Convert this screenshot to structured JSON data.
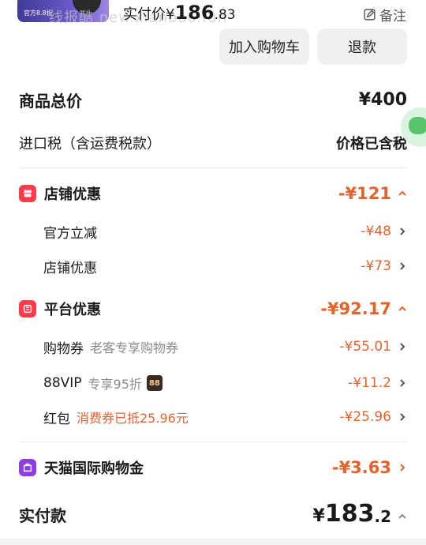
{
  "top": {
    "thumb_text": "官方8.8折",
    "watermark": "线报酷 new.xianbao.fun",
    "paid_label": "实付价",
    "paid_symbol": "¥",
    "paid_int": "186",
    "paid_dec": ".83",
    "note_label": "备注"
  },
  "buttons": {
    "add_cart": "加入购物车",
    "refund": "退款"
  },
  "summary": {
    "total_label": "商品总价",
    "total_value": "¥400",
    "tax_label": "进口税（含运费税款）",
    "tax_value": "价格已含税"
  },
  "store_discount": {
    "label": "店铺优惠",
    "value": "-¥121",
    "items": [
      {
        "label": "官方立减",
        "value": "-¥48"
      },
      {
        "label": "店铺优惠",
        "value": "-¥73"
      }
    ]
  },
  "platform_discount": {
    "label": "平台优惠",
    "value": "-¥92.17",
    "coupon": {
      "label": "购物券",
      "detail": "老客专享购物券",
      "value": "-¥55.01"
    },
    "vip": {
      "label": "88VIP",
      "detail": "专享95折",
      "badge": "88",
      "value": "-¥11.2"
    },
    "redpack": {
      "label": "红包",
      "detail": "消费券已抵25.96元",
      "value": "-¥25.96"
    }
  },
  "tmall": {
    "label": "天猫国际购物金",
    "value": "-¥3.63"
  },
  "paid": {
    "label": "实付款",
    "symbol": "¥",
    "int": "183",
    "dec": ".2"
  },
  "colors": {
    "accent": "#e7612a",
    "red_icon": "#ff3b4a",
    "purple_icon": "#8b3de6"
  }
}
